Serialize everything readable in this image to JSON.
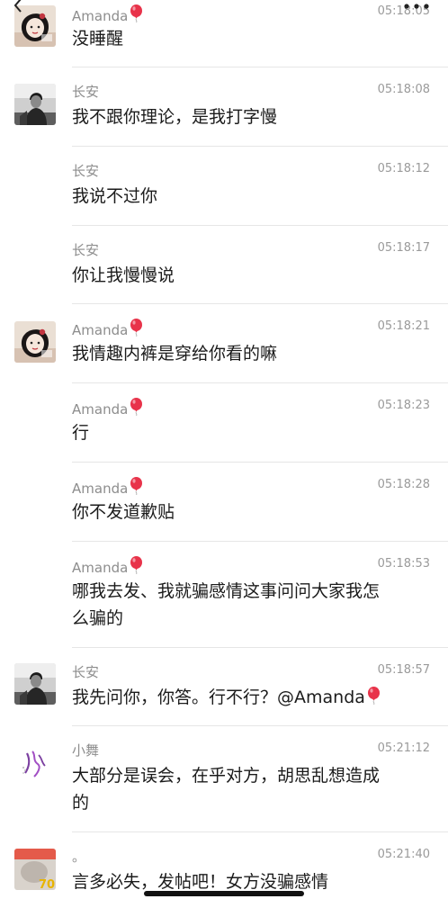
{
  "app": {
    "back_icon": "chevron-left-icon",
    "more_icon": "more-dots-icon"
  },
  "messages": [
    {
      "sender": "Amanda",
      "avatar": "amanda",
      "time": "05:18:05",
      "lines": [
        "没睡醒"
      ]
    },
    {
      "sender": "长安",
      "avatar": "changan",
      "time": "05:18:08",
      "lines": [
        "我不跟你理论，是我打字慢"
      ]
    },
    {
      "sender": "长安",
      "avatar": null,
      "time": "05:18:12",
      "lines": [
        "我说不过你"
      ]
    },
    {
      "sender": "长安",
      "avatar": null,
      "time": "05:18:17",
      "lines": [
        "你让我慢慢说"
      ]
    },
    {
      "sender": "Amanda",
      "avatar": "amanda",
      "time": "05:18:21",
      "lines": [
        "我情趣内裤是穿给你看的嘛"
      ]
    },
    {
      "sender": "Amanda",
      "avatar": null,
      "time": "05:18:23",
      "lines": [
        "行"
      ]
    },
    {
      "sender": "Amanda",
      "avatar": null,
      "time": "05:18:28",
      "lines": [
        "你不发道歉贴"
      ]
    },
    {
      "sender": "Amanda",
      "avatar": null,
      "time": "05:18:53",
      "lines": [
        "哪我去发、我就骗感情这事问问大家我怎",
        "么骗的"
      ]
    },
    {
      "sender": "长安",
      "avatar": "changan",
      "time": "05:18:57",
      "lines": [
        "我先问你，你答。行不行？@Amanda"
      ],
      "mention_balloon": true
    },
    {
      "sender": "小舞",
      "avatar": "xiaowu",
      "time": "05:21:12",
      "lines": [
        "大部分是误会，在乎对方，胡思乱想造成",
        "的"
      ]
    },
    {
      "sender": "。",
      "avatar": "dot",
      "time": "05:21:40",
      "lines": [
        "言多必失，发帖吧！女方没骗感情"
      ]
    }
  ],
  "colors": {
    "balloon": "#e8334a",
    "name": "#8d8d8d",
    "time": "#9a9a9a",
    "divider": "#e6e6e6"
  }
}
